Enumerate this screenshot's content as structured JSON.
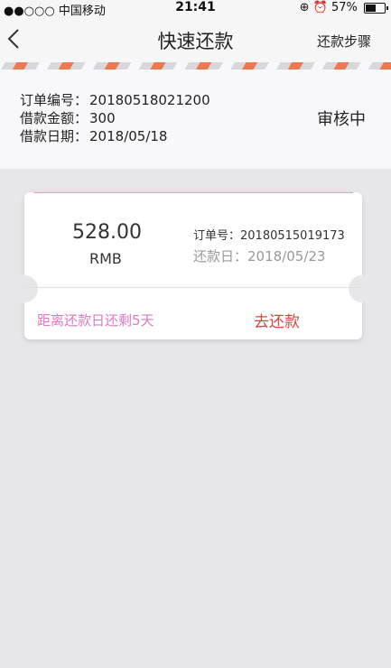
{
  "status_bar": {
    "carrier": "●●○○○ 中国移动",
    "time": "21:41",
    "battery_percent": "57%",
    "battery_level": 0.57
  },
  "nav": {
    "title": "快速还款",
    "steps_label": "还款步骤"
  },
  "order_info": {
    "rows": [
      {
        "label": "订单编号：",
        "value": "20180518021200"
      },
      {
        "label": "借款金额：",
        "value": "300"
      },
      {
        "label": "借款日期：",
        "value": "2018/05/18"
      }
    ],
    "status": "审核中"
  },
  "ticket": {
    "amount": "528.00",
    "currency": "RMB",
    "order_label": "订单号：",
    "order_no": "20180515019173",
    "due_label": "还款日：",
    "due_date": "2018/05/23",
    "countdown": "距离还款日还剩5天",
    "repay_label": "去还款"
  },
  "colors": {
    "accent_pink": "#d77bc3",
    "repay_red": "#e0443d",
    "stripe_orange": "#ed7a4f"
  }
}
